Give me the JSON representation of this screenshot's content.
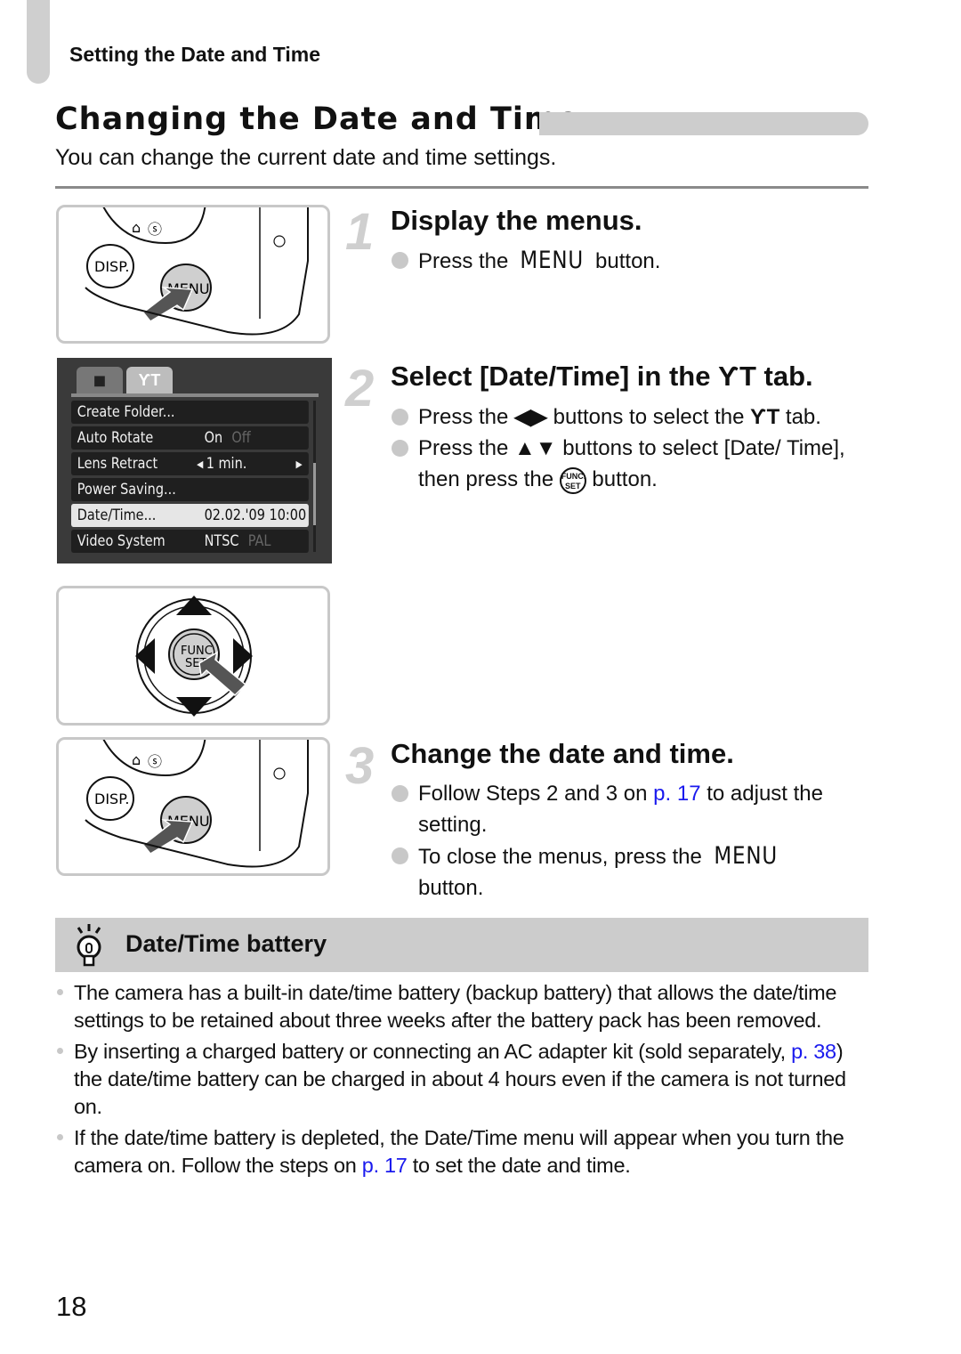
{
  "header": {
    "running_head": "Setting the Date and Time"
  },
  "section": {
    "title": "Changing the Date and Time",
    "intro": "You can change the current date and time settings."
  },
  "illustrations": {
    "camera_buttons": {
      "disp_label": "DISP.",
      "menu_label": "MENU"
    },
    "menu_screen": {
      "tabs": [
        {
          "name": "camera-tab",
          "icon": "camera-icon",
          "glyph": "◼"
        },
        {
          "name": "settings-tab",
          "icon": "wrench-hammer-icon",
          "glyph": "ƳT",
          "active": true
        }
      ],
      "rows": [
        {
          "label": "Create Folder...",
          "value": "",
          "alt": ""
        },
        {
          "label": "Auto Rotate",
          "value": "On",
          "alt": "Off"
        },
        {
          "label": "Lens Retract",
          "value": "1 min.",
          "alt": "",
          "arrows": true
        },
        {
          "label": "Power Saving...",
          "value": "",
          "alt": ""
        },
        {
          "label": "Date/Time...",
          "value": "02.02.'09 10:00",
          "alt": "",
          "selected": true
        },
        {
          "label": "Video System",
          "value": "NTSC",
          "alt": "PAL"
        }
      ]
    },
    "control_dial": {
      "center_label_1": "FUNC.",
      "center_label_2": "SET"
    }
  },
  "steps": [
    {
      "number": "1",
      "title": "Display the menus.",
      "bullets": [
        {
          "pre": "Press the ",
          "menu": "MENU",
          "post": " button."
        }
      ]
    },
    {
      "number": "2",
      "title_pre": "Select [Date/Time] in the ",
      "title_icon": "ƳT",
      "title_post": " tab.",
      "bullets": [
        {
          "pre": "Press the ",
          "arrows": "◀▶",
          "mid": " buttons to select the ",
          "icon": "ƳT",
          "post": " tab."
        },
        {
          "pre": "Press the ",
          "arrows": "▲▼",
          "mid": " buttons to select [Date/ Time], then press the ",
          "func_1": "FUNC.",
          "func_2": "SET",
          "post": " button."
        }
      ]
    },
    {
      "number": "3",
      "title": "Change the date and time.",
      "bullets": [
        {
          "pre": "Follow Steps 2 and 3 on ",
          "link": "p. 17",
          "post": " to adjust the setting."
        },
        {
          "pre": "To close the menus, press the ",
          "menu": "MENU",
          "post": " button."
        }
      ]
    }
  ],
  "tip": {
    "icon": "lightbulb-icon",
    "title": "Date/Time battery",
    "items": [
      {
        "text": "The camera has a built-in date/time battery (backup battery) that allows the date/time settings to be retained about three weeks after the battery pack has been removed."
      },
      {
        "pre": "By inserting a charged battery or connecting an AC adapter kit (sold separately, ",
        "link": "p. 38",
        "post": ") the date/time battery can be charged in about 4 hours even if the camera is not turned on."
      },
      {
        "pre": "If the date/time battery is depleted, the Date/Time menu will appear when you turn the camera on. Follow the steps on ",
        "link": "p. 17",
        "post": " to set the date and time."
      }
    ]
  },
  "footer": {
    "page_number": "18"
  },
  "colors": {
    "link": "#1a1aee",
    "accent_gray": "#cccccc"
  }
}
